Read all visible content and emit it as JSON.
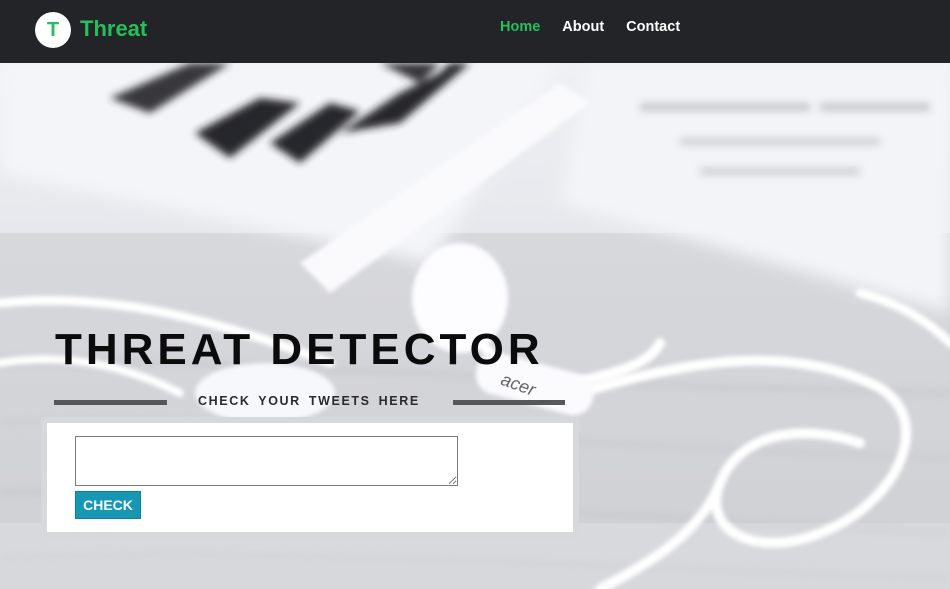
{
  "header": {
    "logo_letter": "T",
    "brand": "Threat",
    "nav": [
      {
        "label": "Home",
        "active": true
      },
      {
        "label": "About",
        "active": false
      },
      {
        "label": "Contact",
        "active": false
      }
    ]
  },
  "hero": {
    "background_icon": "desk-earphones-photo",
    "title": "THREAT DETECTOR",
    "subtitle": "CHECK YOUR TWEETS HERE"
  },
  "form": {
    "tweet_value": "",
    "button_label": "CHECK"
  },
  "colors": {
    "header_bg": "#232427",
    "accent_green": "#22c15a",
    "button_teal": "#1598b3"
  }
}
